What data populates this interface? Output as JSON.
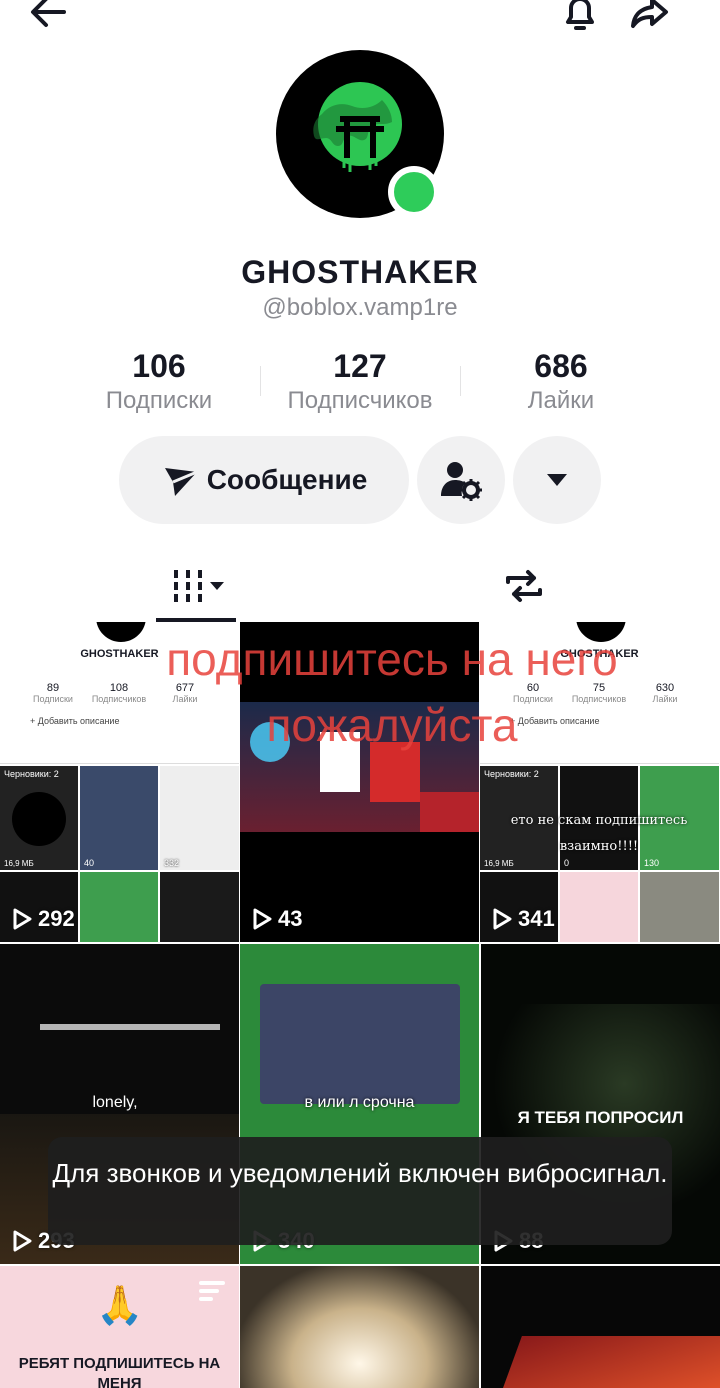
{
  "profile": {
    "display_name": "GHOSTHAKER",
    "handle": "@boblox.vamp1re",
    "stats": [
      {
        "value": "106",
        "label": "Подписки"
      },
      {
        "value": "127",
        "label": "Подписчиков"
      },
      {
        "value": "686",
        "label": "Лайки"
      }
    ],
    "message_button": "Сообщение"
  },
  "overlay_caption": "подпишитесь на него пожалуйста",
  "videos": [
    {
      "plays": "292",
      "mini": {
        "name": "GHOSTHAKER",
        "stats": [
          "89",
          "108",
          "677"
        ],
        "labels": [
          "Подписки",
          "Подписчиков",
          "Лайки"
        ],
        "desc": "+ Добавить описание",
        "drafts": "Черновики: 2",
        "size": "16,9 МБ",
        "c1": "40",
        "c2": "332"
      }
    },
    {
      "plays": "43",
      "caption": ""
    },
    {
      "plays": "341",
      "mini": {
        "name": "GHOSTHAKER",
        "stats": [
          "60",
          "75",
          "630"
        ],
        "labels": [
          "Подписки",
          "Подписчиков",
          "Лайки"
        ],
        "desc": "+ Добавить описание",
        "drafts": "Черновики: 2",
        "size": "16,9 МБ",
        "c1": "0",
        "c2": "130"
      },
      "overlay": "ето не скам подпишитесь взаимно!!!!"
    },
    {
      "plays": "293",
      "caption": "lonely,"
    },
    {
      "plays": "340",
      "caption": "в или л срочна"
    },
    {
      "plays": "88",
      "caption": "Я ТЕБЯ ПОПРОСИЛ"
    },
    {
      "caption": "РЕБЯТ ПОДПИШИТЕСЬ НА МЕНЯ"
    },
    {
      "caption": ""
    },
    {
      "caption": ""
    }
  ],
  "toast": {
    "text": "Для звонков и уведомлений включен вибросигнал."
  },
  "colors": {
    "online": "#2ecc5a",
    "overlay": "#e8423c",
    "toast_bg": "#1e1e1e"
  }
}
